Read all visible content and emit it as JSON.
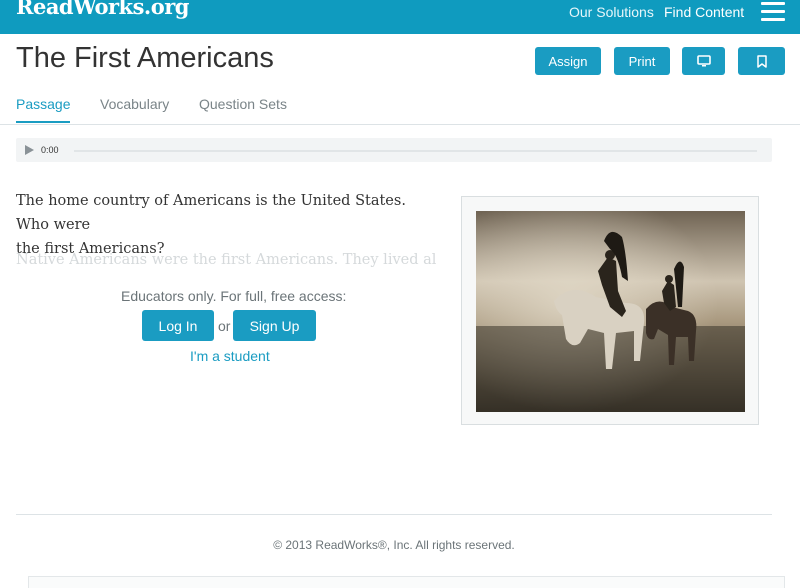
{
  "header": {
    "logo": "ReadWorks.org",
    "nav": [
      "Our Solutions",
      "Find Content"
    ],
    "menu_icon": "hamburger-menu-icon"
  },
  "article": {
    "title": "The First Americans",
    "actions": {
      "assign": "Assign",
      "print": "Print",
      "present_icon": "monitor-icon",
      "bookmark_icon": "bookmark-icon"
    },
    "tabs": [
      {
        "label": "Passage",
        "active": true
      },
      {
        "label": "Vocabulary",
        "active": false
      },
      {
        "label": "Question Sets",
        "active": false
      }
    ]
  },
  "audio": {
    "time": "0:00",
    "play_icon": "play-icon"
  },
  "passage": {
    "line1": "The home country of Americans is the United States. Who were",
    "line2": "the first Americans?",
    "faded": "Native Americans were the first Americans. They lived all..."
  },
  "access": {
    "message": "Educators only. For full, free access:",
    "login": "Log In",
    "or": "or",
    "signup": "Sign Up",
    "student": "I'm a student"
  },
  "footer": {
    "copyright": "© 2013 ReadWorks®, Inc. All rights reserved."
  },
  "colors": {
    "brand": "#0f9bbf",
    "button": "#1a9cc2"
  }
}
